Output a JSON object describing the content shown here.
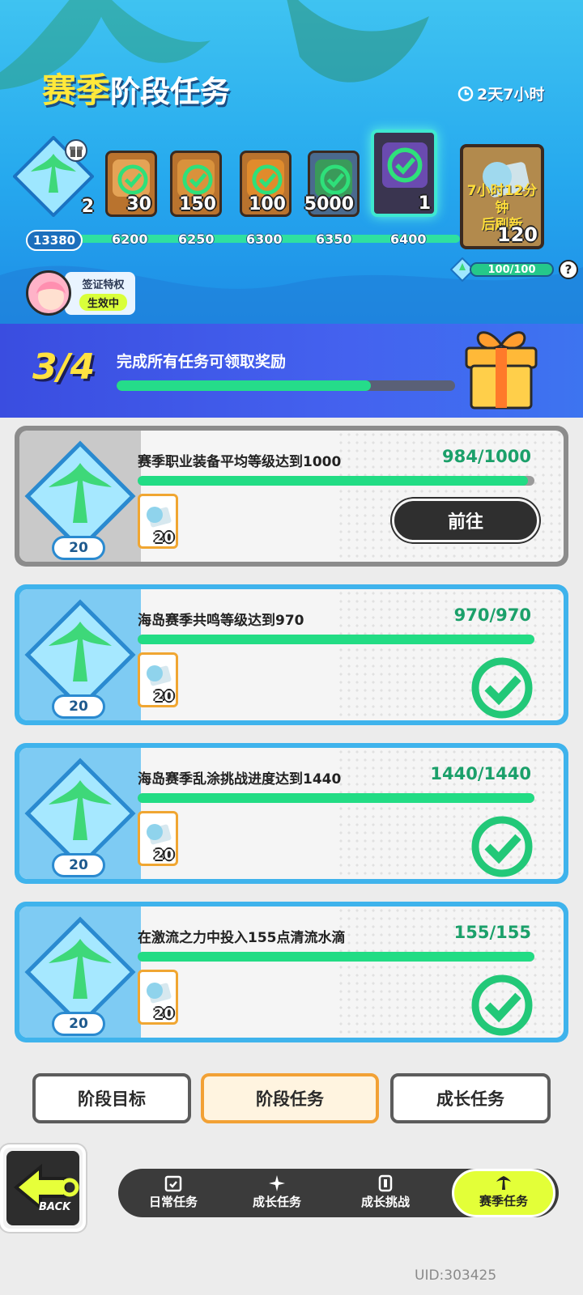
{
  "header": {
    "title_highlight": "赛季",
    "title_rest": "阶段任务",
    "timer_text": "2天7小时"
  },
  "rewards": {
    "partial_count": "2",
    "items": [
      {
        "count": "30",
        "claimed": true,
        "color": "#d28a3a"
      },
      {
        "count": "150",
        "claimed": true,
        "color": "#c97b2f"
      },
      {
        "count": "100",
        "claimed": true,
        "color": "#d07a28"
      },
      {
        "count": "5000",
        "claimed": true,
        "color": "#3b8a54"
      },
      {
        "count": "1",
        "claimed": true,
        "color": "#6a4bb0"
      }
    ],
    "next": {
      "refresh_text_1": "7小时12分钟",
      "refresh_text_2": "后刷新",
      "count": "120"
    },
    "track_start": "13380",
    "milestones": [
      "6200",
      "6250",
      "6300",
      "6350",
      "6400"
    ],
    "cap_text": "100/100",
    "help": "?"
  },
  "visa": {
    "line1": "签证特权",
    "line2": "生效中"
  },
  "stage": {
    "count": "3/4",
    "desc": "完成所有任务可领取奖励",
    "progress": 0.75
  },
  "tasks": [
    {
      "name": "赛季职业装备平均等级达到1000",
      "progress_text": "984/1000",
      "progress": 0.984,
      "level": "20",
      "reward_count": "20",
      "action": "前往",
      "done": false
    },
    {
      "name": "海岛赛季共鸣等级达到970",
      "progress_text": "970/970",
      "progress": 1.0,
      "level": "20",
      "reward_count": "20",
      "done": true
    },
    {
      "name": "海岛赛季乱涂挑战进度达到1440",
      "progress_text": "1440/1440",
      "progress": 1.0,
      "level": "20",
      "reward_count": "20",
      "done": true
    },
    {
      "name": "在激流之力中投入155点清流水滴",
      "progress_text": "155/155",
      "progress": 1.0,
      "level": "20",
      "reward_count": "20",
      "done": true
    }
  ],
  "tabs": [
    "阶段目标",
    "阶段任务",
    "成长任务"
  ],
  "selected_tab": "阶段任务",
  "nav": [
    {
      "label": "日常任务",
      "icon": "calendar-check-icon"
    },
    {
      "label": "成长任务",
      "icon": "sparkle-icon"
    },
    {
      "label": "成长挑战",
      "icon": "trophy-icon"
    },
    {
      "label": "赛季任务",
      "icon": "palm-tree-icon"
    }
  ],
  "back_label": "BACK",
  "uid": "UID:303425",
  "colors": {
    "accent_green": "#22dc84",
    "header_blue": "#26a9ee",
    "stage_blue": "#4462ef",
    "tab_selected": "#f2a135",
    "nav_selected": "#e3ff38"
  }
}
